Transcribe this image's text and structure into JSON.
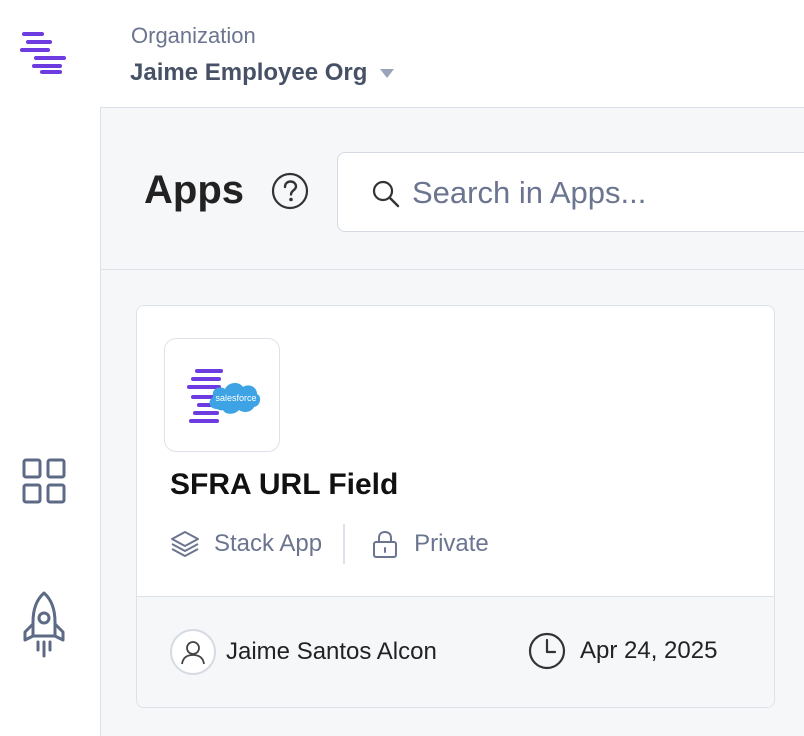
{
  "rail": {
    "logo_icon": "stack-logo-icon",
    "items": [
      {
        "icon": "apps-grid-icon"
      },
      {
        "icon": "rocket-icon"
      }
    ]
  },
  "org": {
    "label": "Organization",
    "name": "Jaime Employee Org"
  },
  "page": {
    "title": "Apps",
    "help_icon": "help-circle-icon"
  },
  "search": {
    "placeholder": "Search in Apps..."
  },
  "card": {
    "app_name": "SFRA URL Field",
    "logo_text": "salesforce",
    "type_label": "Stack App",
    "visibility_label": "Private",
    "author": "Jaime Santos Alcon",
    "date": "Apr 24, 2025"
  },
  "colors": {
    "brand": "#6c3ce0",
    "muted_text": "#6b7590",
    "border": "#dde2ea",
    "background": "#f6f7f9",
    "salesforce_blue": "#3da3e4"
  }
}
